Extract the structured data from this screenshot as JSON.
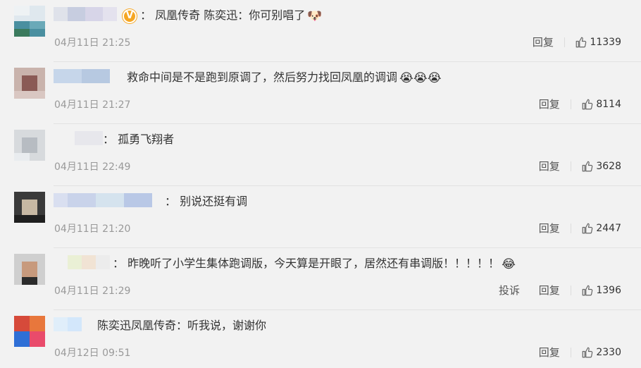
{
  "comments": [
    {
      "text": "：  凤凰传奇 陈奕迅：你可别唱了",
      "emoji": "🐶",
      "emoji_name": "doge-icon",
      "verified": true,
      "verified_label": "V",
      "time": "04月11日 21:25",
      "reply_label": "回复",
      "likes": "11339"
    },
    {
      "text": "救命中间是不是跑到原调了，然后努力找回凤凰的调调",
      "emoji": "😭😭😭",
      "emoji_name": "crying-face-icon",
      "time": "04月11日 21:27",
      "reply_label": "回复",
      "likes": "8114"
    },
    {
      "text": "：  孤勇飞翔者",
      "time": "04月11日 22:49",
      "reply_label": "回复",
      "likes": "3628"
    },
    {
      "text": "：  别说还挺有调",
      "time": "04月11日 21:20",
      "reply_label": "回复",
      "likes": "2447"
    },
    {
      "text": "：  昨晚听了小学生集体跑调版，今天算是开眼了，居然还有串调版！！！！！",
      "emoji": "😂",
      "emoji_name": "laughing-crying-icon",
      "time": "04月11日 21:29",
      "report_label": "投诉",
      "reply_label": "回复",
      "likes": "1396"
    },
    {
      "text": "陈奕迅凤凰传奇：听我说，谢谢你",
      "time": "04月12日 09:51",
      "reply_label": "回复",
      "likes": "2330"
    }
  ],
  "colors": {
    "background": "#f2f2f2",
    "text": "#333333",
    "meta": "#999999",
    "verified": "#f5a623"
  }
}
